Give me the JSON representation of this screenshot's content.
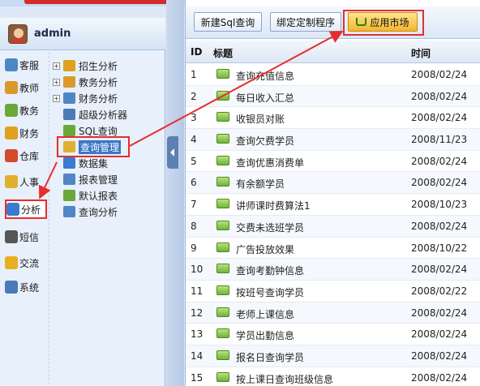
{
  "user": {
    "name": "admin"
  },
  "categories": [
    {
      "label": "客服",
      "color": "#4f86c6"
    },
    {
      "label": "教师",
      "color": "#d99a2a"
    },
    {
      "label": "教务",
      "color": "#6aa83a"
    },
    {
      "label": "财务",
      "color": "#e0a020"
    },
    {
      "label": "仓库",
      "color": "#d24a2a"
    },
    {
      "label": "人事",
      "color": "#e0b030"
    },
    {
      "label": "分析",
      "color": "#3a7ad0"
    },
    {
      "label": "短信",
      "color": "#555555"
    },
    {
      "label": "交流",
      "color": "#e8b020"
    },
    {
      "label": "系统",
      "color": "#4a7ab8"
    }
  ],
  "tree": [
    {
      "label": "招生分析",
      "expander": "+"
    },
    {
      "label": "教务分析",
      "expander": "+"
    },
    {
      "label": "财务分析",
      "expander": "+"
    },
    {
      "label": "超级分析器",
      "expander": ""
    },
    {
      "label": "SQL查询",
      "expander": ""
    },
    {
      "label": "查询管理",
      "expander": ""
    },
    {
      "label": "数据集",
      "expander": ""
    },
    {
      "label": "报表管理",
      "expander": ""
    },
    {
      "label": "默认报表",
      "expander": ""
    },
    {
      "label": "查询分析",
      "expander": ""
    }
  ],
  "toolbar": {
    "new_sql": "新建Sql查询",
    "bind_program": "绑定定制程序",
    "app_market": "应用市场"
  },
  "grid": {
    "headers": {
      "id": "ID",
      "title": "标题",
      "time": "时间"
    },
    "rows": [
      {
        "id": "1",
        "title": "查询充值信息",
        "time": "2008/02/24"
      },
      {
        "id": "2",
        "title": "每日收入汇总",
        "time": "2008/02/24"
      },
      {
        "id": "3",
        "title": "收银员对账",
        "time": "2008/02/24"
      },
      {
        "id": "4",
        "title": "查询欠费学员",
        "time": "2008/11/23"
      },
      {
        "id": "5",
        "title": "查询优惠消费单",
        "time": "2008/02/24"
      },
      {
        "id": "6",
        "title": "有余额学员",
        "time": "2008/02/24"
      },
      {
        "id": "7",
        "title": "讲师课时费算法1",
        "time": "2008/10/23"
      },
      {
        "id": "8",
        "title": "交费未选班学员",
        "time": "2008/02/24"
      },
      {
        "id": "9",
        "title": "广告投放效果",
        "time": "2008/10/22"
      },
      {
        "id": "10",
        "title": "查询考勤钟信息",
        "time": "2008/02/24"
      },
      {
        "id": "11",
        "title": "按班号查询学员",
        "time": "2008/02/22"
      },
      {
        "id": "12",
        "title": "老师上课信息",
        "time": "2008/02/24"
      },
      {
        "id": "13",
        "title": "学员出勤信息",
        "time": "2008/02/24"
      },
      {
        "id": "14",
        "title": "报名日查询学员",
        "time": "2008/02/24"
      },
      {
        "id": "15",
        "title": "按上课日查询班级信息",
        "time": "2008/02/24"
      }
    ]
  }
}
